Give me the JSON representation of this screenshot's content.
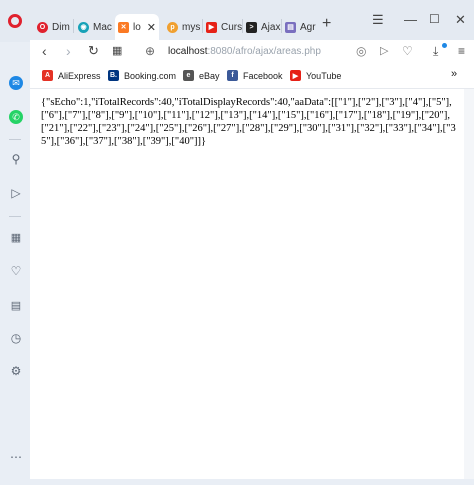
{
  "tabs": [
    {
      "label": "Dim",
      "icon": "opera-icon",
      "color": "#e0212e"
    },
    {
      "label": "Mac",
      "icon": "globe-icon",
      "color": "#17a2b8"
    },
    {
      "label": "lo",
      "icon": "xampp-icon",
      "color": "#fb7a24",
      "active": true
    },
    {
      "label": "mys",
      "icon": "php-icon",
      "color": "#f0a030"
    },
    {
      "label": "Curs",
      "icon": "youtube-icon",
      "color": "#e62117"
    },
    {
      "label": "Ajax",
      "icon": "code-icon",
      "color": "#222222"
    },
    {
      "label": "Agr",
      "icon": "page-icon",
      "color": "#7a6fbf"
    }
  ],
  "address": {
    "host": "localhost",
    "path": ":8080/afro/ajax/areas.php"
  },
  "bookmarks": [
    {
      "label": "AliExpress",
      "icon": "aliexpress-icon",
      "color": "#e43225"
    },
    {
      "label": "Booking.com",
      "icon": "booking-icon",
      "color": "#003580"
    },
    {
      "label": "eBay",
      "icon": "ebay-icon",
      "color": "#555555"
    },
    {
      "label": "Facebook",
      "icon": "facebook-icon",
      "color": "#3b5998"
    },
    {
      "label": "YouTube",
      "icon": "youtube-icon",
      "color": "#e62117"
    }
  ],
  "page_text": "{\"sEcho\":1,\"iTotalRecords\":40,\"iTotalDisplayRecords\":40,\"aaData\":[[\"1\"],[\"2\"],[\"3\"],[\"4\"],[\"5\"],[\"6\"],[\"7\"],[\"8\"],[\"9\"],[\"10\"],[\"11\"],[\"12\"],[\"13\"],[\"14\"],[\"15\"],[\"16\"],[\"17\"],[\"18\"],[\"19\"],[\"20\"],[\"21\"],[\"22\"],[\"23\"],[\"24\"],[\"25\"],[\"26\"],[\"27\"],[\"28\"],[\"29\"],[\"30\"],[\"31\"],[\"32\"],[\"33\"],[\"34\"],[\"35\"],[\"36\"],[\"37\"],[\"38\"],[\"39\"],[\"40\"]]}"
}
